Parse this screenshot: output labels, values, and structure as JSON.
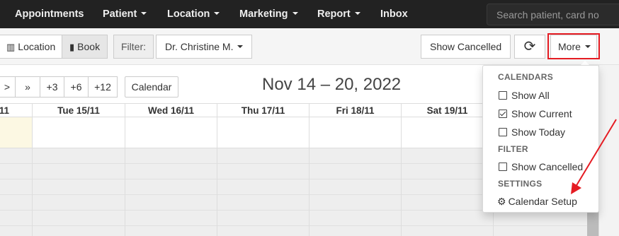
{
  "nav": {
    "items": [
      "Appointments",
      "Patient",
      "Location",
      "Marketing",
      "Report",
      "Inbox"
    ],
    "search_placeholder": "Search patient, card no"
  },
  "toolbar": {
    "location_label": "Location",
    "book_label": "Book",
    "filter_label": "Filter:",
    "doctor_label": "Dr. Christine M.",
    "show_cancelled_label": "Show Cancelled",
    "more_label": "More"
  },
  "calendar": {
    "nav_buttons": [
      ">",
      "»",
      "+3",
      "+6",
      "+12"
    ],
    "calendar_button": "Calendar",
    "date_range": "Nov 14 – 20, 2022",
    "days": [
      "11",
      "Tue 15/11",
      "Wed 16/11",
      "Thu 17/11",
      "Fri 18/11",
      "Sat 19/11"
    ]
  },
  "menu": {
    "calendars_header": "CALENDARS",
    "show_all": "Show All",
    "show_current": "Show Current",
    "show_today": "Show Today",
    "filter_header": "FILTER",
    "show_cancelled": "Show Cancelled",
    "settings_header": "SETTINGS",
    "calendar_setup": "Calendar Setup",
    "show_current_checked": true
  },
  "colors": {
    "nav_bg": "#222222",
    "highlight": "#e51c23",
    "today_bg": "#fcf8e3",
    "arrow": "#e51c23"
  }
}
